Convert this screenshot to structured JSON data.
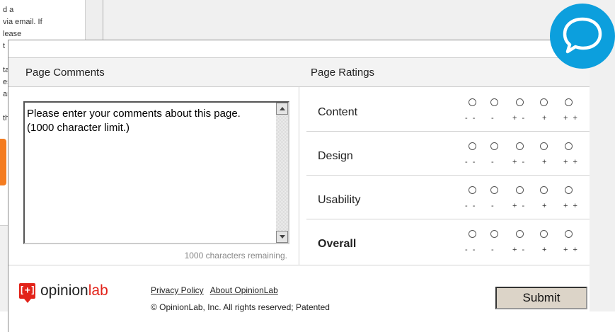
{
  "background": {
    "left_panel_text": "d a\nvia email. If\nlease\nt\n\nta\nest\nan\n\nthi"
  },
  "feedback": {
    "comments_header": "Page Comments",
    "ratings_header": "Page Ratings",
    "comment_text": "Please enter your comments about this page. (1000 character limit.)",
    "chars_remaining": "1000 characters remaining.",
    "scale": [
      "- -",
      "-",
      "+ -",
      "+",
      "+ +"
    ],
    "rows": [
      {
        "label": "Content"
      },
      {
        "label": "Design"
      },
      {
        "label": "Usability"
      },
      {
        "label": "Overall"
      }
    ]
  },
  "footer": {
    "logo_mark": "[+]",
    "logo_opinion": "opinion",
    "logo_lab": "lab",
    "privacy_link": "Privacy Policy",
    "about_link": "About OpinionLab",
    "copyright": "© OpinionLab, Inc. All rights reserved; Patented",
    "submit_label": "Submit"
  },
  "colors": {
    "chat_bubble": "#0c9fdd",
    "logo_red": "#e2231a",
    "orange_accent": "#f47c20"
  },
  "icons": {
    "chat": "speech-bubble-icon"
  }
}
